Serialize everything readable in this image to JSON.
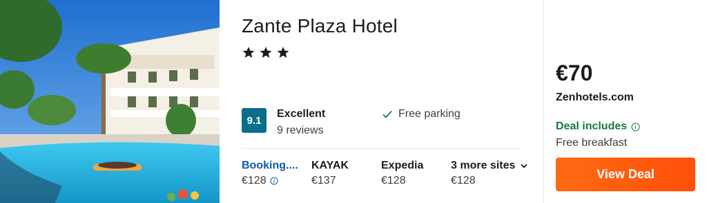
{
  "hotel": {
    "name": "Zante Plaza Hotel",
    "star_rating": 3
  },
  "rating": {
    "score": "9.1",
    "label": "Excellent",
    "reviews": "9 reviews",
    "badge_color": "#0b6e8a"
  },
  "amenity": {
    "label": "Free parking",
    "icon": "check-icon"
  },
  "sites": [
    {
      "name": "Booking....",
      "price": "€128",
      "has_info_icon": true
    },
    {
      "name": "KAYAK",
      "price": "€137"
    },
    {
      "name": "Expedia",
      "price": "€128"
    },
    {
      "name": "3 more sites",
      "price": "€128",
      "icon": "chevron-down-icon"
    }
  ],
  "deal": {
    "price": "€70",
    "provider": "Zenhotels.com",
    "includes_label": "Deal includes",
    "includes_detail": "Free breakfast",
    "button_label": "View Deal",
    "accent_color": "#ff5a0f",
    "includes_color": "#157a3b"
  },
  "photo": {
    "icon": "hotel-photo",
    "description_colors": {
      "sky": "#2f80d8",
      "pool": "#29b6e8",
      "building": "#f4f1ea"
    }
  }
}
